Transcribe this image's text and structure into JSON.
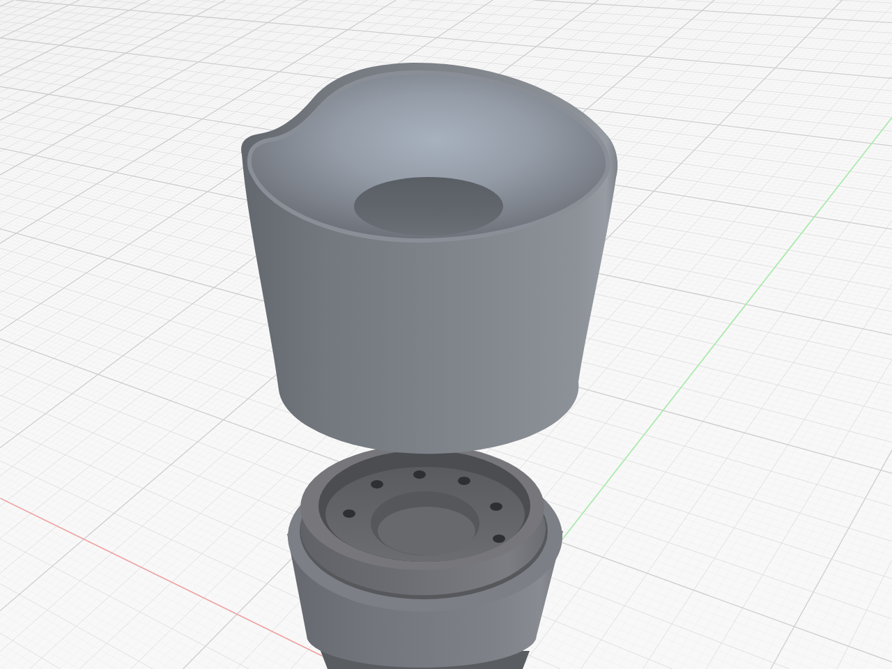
{
  "viewport": {
    "axes": [
      {
        "kind": "x",
        "color": "#f4a3a3"
      },
      {
        "kind": "y",
        "color": "#a8eea8"
      }
    ],
    "parts": [
      {
        "kind": "cup"
      },
      {
        "kind": "base"
      }
    ]
  }
}
